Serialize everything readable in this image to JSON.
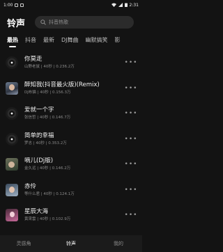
{
  "status_bar": {
    "time": "1:00",
    "right_time": "2:31"
  },
  "header": {
    "title": "铃声",
    "search_placeholder": "抖音热歌"
  },
  "tabs": [
    "最热",
    "抖音",
    "最新",
    "DJ舞曲",
    "幽默搞笑",
    "影"
  ],
  "songs": [
    {
      "title": "你莫走",
      "meta": "山野老鼠 | 40秒 | 0.236.2万",
      "cover": "disc"
    },
    {
      "title": "醉知我(抖音最火版)(Remix)",
      "meta": "DJ布猫 | 40秒 | 0.156.3万",
      "cover": "portrait"
    },
    {
      "title": "爱就一个字",
      "meta": "张信哲 | 40秒 | 0.146.7万",
      "cover": "disc"
    },
    {
      "title": "简单的幸福",
      "meta": "罗志 | 40秒 | 0.353.2万",
      "cover": "disc"
    },
    {
      "title": "嘀儿(Dj版)",
      "meta": "金久远 | 40秒 | 0.146.2万",
      "cover": "portrait3"
    },
    {
      "title": "赤伶",
      "meta": "等什么君 | 40秒 | 0.124.1万",
      "cover": "portrait2"
    },
    {
      "title": "星辰大海",
      "meta": "黄霄雲 | 40秒 | 0.102.9万",
      "cover": "pink"
    }
  ],
  "bottom_nav": [
    "灵感角",
    "铃声",
    "我的"
  ]
}
